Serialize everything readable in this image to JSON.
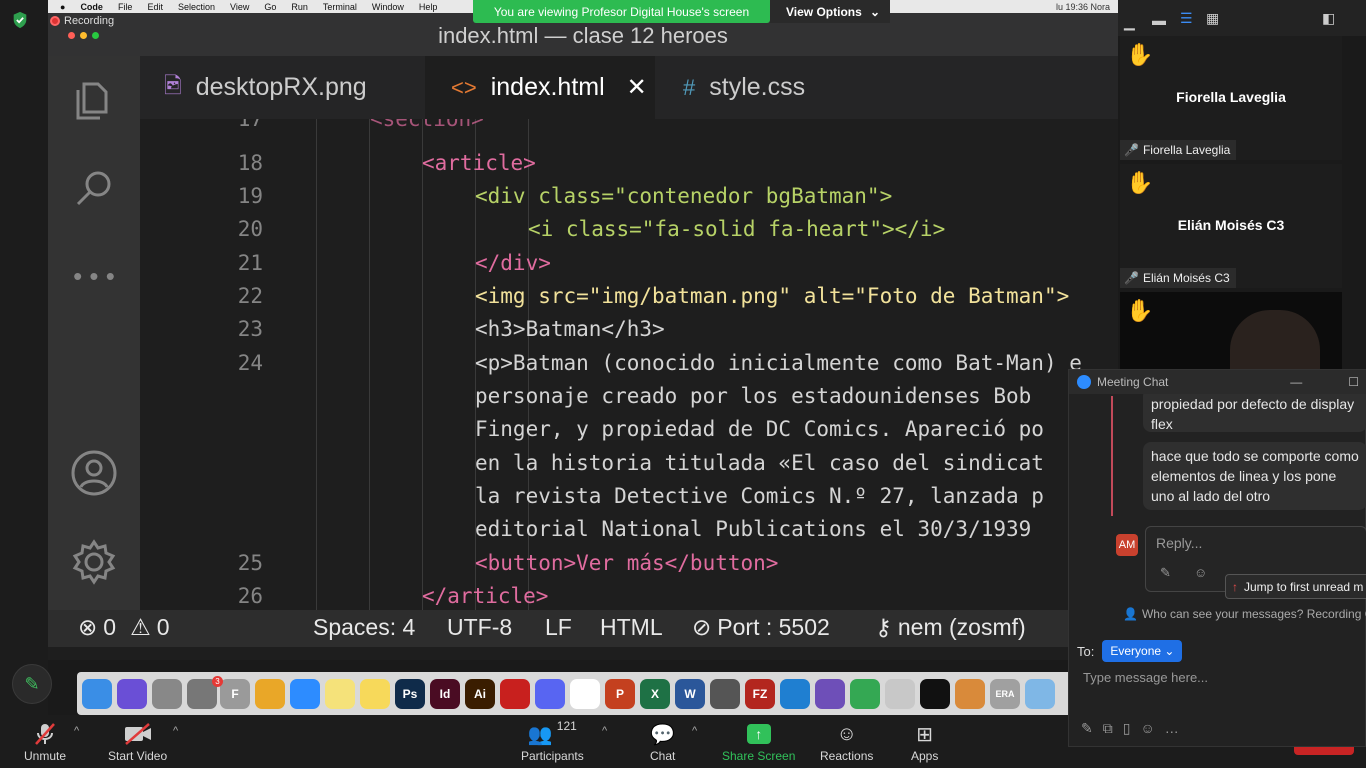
{
  "menubar": {
    "app_name": "Code",
    "items": [
      "File",
      "Edit",
      "Selection",
      "View",
      "Go",
      "Run",
      "Terminal",
      "Window",
      "Help"
    ],
    "clock": "lu 19:36   Nora"
  },
  "recording_label": "Recording",
  "share_banner": "You are viewing Profesor Digital House's screen",
  "view_options": "View Options",
  "window_title": "index.html — clase 12 heroes",
  "tabs": [
    {
      "label": "desktopRX.png",
      "icon": "image-icon"
    },
    {
      "label": "index.html",
      "icon": "code-icon",
      "close": "✕"
    },
    {
      "label": "style.css",
      "icon": "hash-icon"
    }
  ],
  "editor": {
    "line_numbers": [
      "17",
      "18",
      "19",
      "20",
      "21",
      "22",
      "23",
      "",
      "24",
      "",
      "",
      "",
      "",
      "",
      "25",
      "26"
    ],
    "lines": [
      "<section>",
      "<article>",
      "<div class=\"contenedor bgBatman\">",
      "<i class=\"fa-solid fa-heart\"></i>",
      "</div>",
      "<img src=\"img/batman.png\" alt=\"Foto de Batman\">",
      "<h3>Batman</h3>",
      "<p>Batman (conocido inicialmente como Bat-Man) e",
      "personaje creado por los estadounidenses Bob",
      "Finger, y propiedad de DC Comics. Apareció po",
      "en la historia titulada «El caso del sindicat",
      "la revista Detective Comics N.º 27, lanzada p",
      "editorial National Publications el 30/3/1939",
      "<button>Ver más</button>",
      "</article>"
    ]
  },
  "statusbar": {
    "errors": "0",
    "warnings": "0",
    "spaces": "Spaces: 4",
    "encoding": "UTF-8",
    "eol": "LF",
    "language": "HTML",
    "port": "Port : 5502",
    "user": "nem (zosmf)"
  },
  "dock": {
    "apps": [
      {
        "name": "finder",
        "label": "",
        "color": "#3a8ee6"
      },
      {
        "name": "siri",
        "label": "",
        "color": "#6a4fd6"
      },
      {
        "name": "launchpad",
        "label": "",
        "color": "#888888"
      },
      {
        "name": "settings",
        "label": "",
        "color": "#777777"
      },
      {
        "name": "font-book",
        "label": "F",
        "color": "#9a9a9a"
      },
      {
        "name": "chrome",
        "label": "",
        "color": "#e9a728"
      },
      {
        "name": "zoom",
        "label": "",
        "color": "#2d8cff"
      },
      {
        "name": "notes",
        "label": "",
        "color": "#f5e27a"
      },
      {
        "name": "stickies",
        "label": "",
        "color": "#f7d95a"
      },
      {
        "name": "photoshop",
        "label": "Ps",
        "color": "#0f2b4a"
      },
      {
        "name": "indesign",
        "label": "Id",
        "color": "#4a0c23"
      },
      {
        "name": "illustrator",
        "label": "Ai",
        "color": "#3a1d00"
      },
      {
        "name": "acrobat",
        "label": "",
        "color": "#c8201e"
      },
      {
        "name": "discord",
        "label": "",
        "color": "#5865f2"
      },
      {
        "name": "slack",
        "label": "",
        "color": "#ffffff"
      },
      {
        "name": "powerpoint",
        "label": "P",
        "color": "#c4401f"
      },
      {
        "name": "excel",
        "label": "X",
        "color": "#1e7145"
      },
      {
        "name": "word",
        "label": "W",
        "color": "#2b579a"
      },
      {
        "name": "calculator",
        "label": "",
        "color": "#555555"
      },
      {
        "name": "filezilla",
        "label": "FZ",
        "color": "#b3261e"
      },
      {
        "name": "vscode",
        "label": "",
        "color": "#1f7fd1"
      },
      {
        "name": "github",
        "label": "",
        "color": "#6e4fb8"
      },
      {
        "name": "drive",
        "label": "",
        "color": "#34a853"
      },
      {
        "name": "preview",
        "label": "",
        "color": "#c8c8c8"
      },
      {
        "name": "terminal",
        "label": "",
        "color": "#111111"
      },
      {
        "name": "photos",
        "label": "",
        "color": "#d98a3a"
      },
      {
        "name": "era",
        "label": "ERA",
        "color": "#a0a0a0"
      },
      {
        "name": "folder",
        "label": "",
        "color": "#7fb7e6"
      }
    ],
    "settings_badge": "3"
  },
  "zoom_toolbar": {
    "unmute": "Unmute",
    "start_video": "Start Video",
    "participants": "Participants",
    "participants_count": "121",
    "chat": "Chat",
    "share_screen": "Share Screen",
    "reactions": "Reactions",
    "apps": "Apps"
  },
  "participants": [
    {
      "name": "Fiorella Laveglia",
      "label": "Fiorella Laveglia"
    },
    {
      "name": "Elián Moisés C3",
      "label": "Elián Moisés C3"
    }
  ],
  "chat": {
    "title": "Meeting Chat",
    "messages": [
      "propiedad por defecto de display flex",
      "hace que todo se comporte como elementos de linea y los pone uno al lado del otro"
    ],
    "avatar_initials": "AM",
    "reply_placeholder": "Reply...",
    "jump_label": "Jump to first unread m",
    "visibility_note": "Who can see your messages? Recording On",
    "to_label": "To:",
    "recipient": "Everyone",
    "input_placeholder": "Type message here..."
  },
  "colors": {
    "share_banner": "#2dbb51",
    "accent_blue": "#1f6fe5",
    "html_tag": "#e06c9f",
    "html_attr": "#b7d267",
    "html_string": "#f2e29b"
  }
}
